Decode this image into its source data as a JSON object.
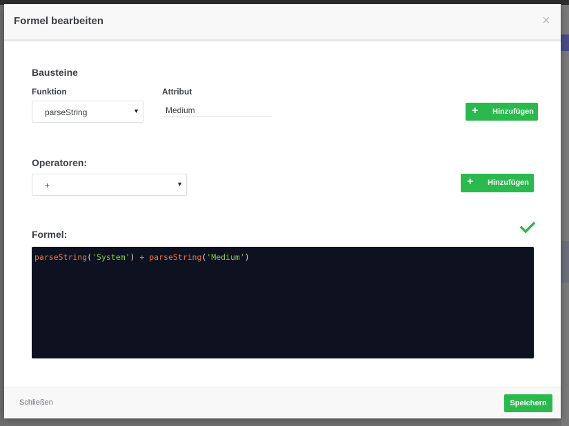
{
  "modal": {
    "title": "Formel bearbeiten",
    "close_symbol": "×"
  },
  "bausteine": {
    "title": "Bausteine",
    "funktion_label": "Funktion",
    "funktion_value": "parseString",
    "attribut_label": "Attribut",
    "attribut_value": "Medium",
    "add_label": "Hinzufügen"
  },
  "operatoren": {
    "title": "Operatoren:",
    "value": "+",
    "add_label": "Hinzufügen"
  },
  "formel": {
    "title": "Formel:",
    "valid_icon": "check-icon",
    "tokens": {
      "fn1": "parseString",
      "open1": "(",
      "arg1": "'System'",
      "close1": ")",
      "op": "+",
      "fn2": "parseString",
      "open2": "(",
      "arg2": "'Medium'",
      "close2": ")"
    }
  },
  "footer": {
    "close_label": "Schließen",
    "save_label": "Speichern"
  },
  "colors": {
    "accent_green": "#2bb84c",
    "editor_bg": "#0e1120",
    "code_function": "#f0733f",
    "code_string": "#7fd13b"
  },
  "icons": {
    "plus": "plus-icon",
    "caret": "chevron-down-icon",
    "close": "close-icon"
  }
}
